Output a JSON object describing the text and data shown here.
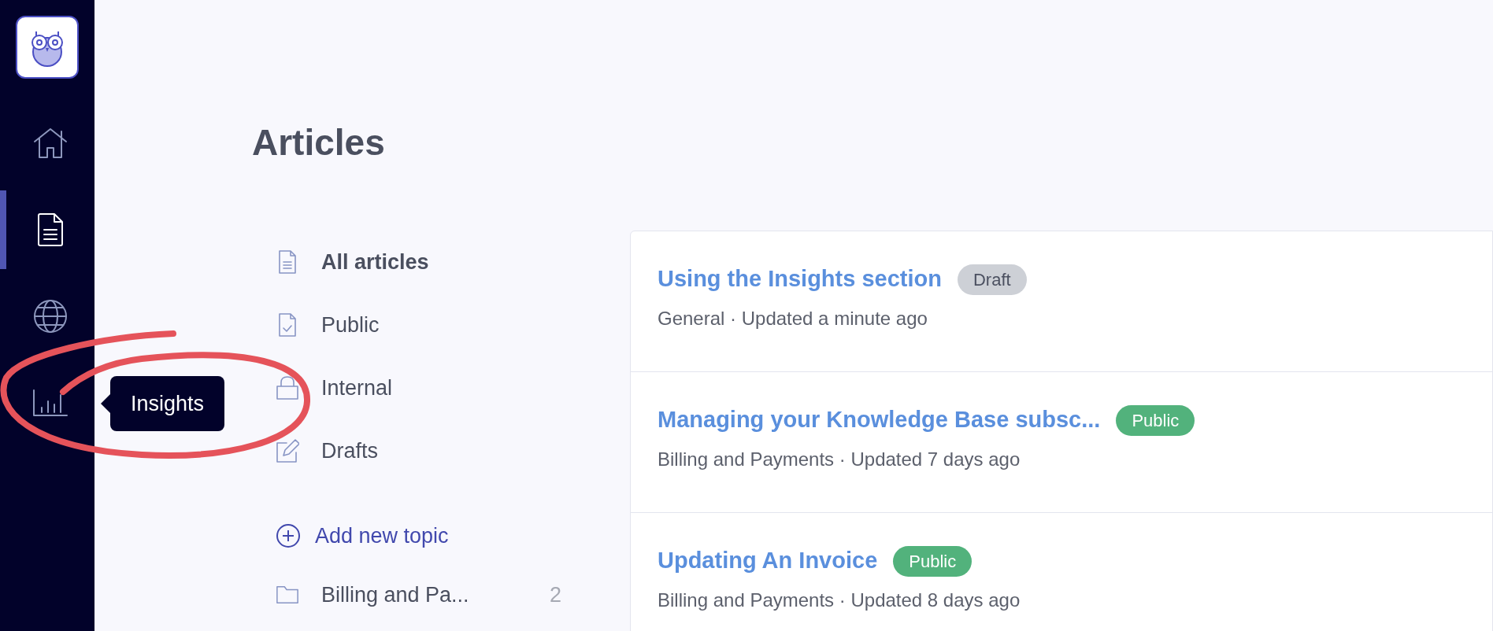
{
  "sidebar": {
    "items": [
      {
        "kind": "home",
        "selected": false
      },
      {
        "kind": "articles",
        "selected": true
      },
      {
        "kind": "globe",
        "selected": false
      },
      {
        "kind": "insights",
        "selected": false
      }
    ],
    "tooltip": "Insights"
  },
  "page_title": "Articles",
  "filters": [
    {
      "kind": "all",
      "label": "All articles",
      "selected": true
    },
    {
      "kind": "public",
      "label": "Public",
      "selected": false
    },
    {
      "kind": "internal",
      "label": "Internal",
      "selected": false
    },
    {
      "kind": "drafts",
      "label": "Drafts",
      "selected": false
    }
  ],
  "add_topic": "Add new topic",
  "topics": [
    {
      "label": "Billing and Pa...",
      "count": "2"
    }
  ],
  "articles": [
    {
      "title": "Using the Insights section",
      "status": {
        "label": "Draft",
        "kind": "draft"
      },
      "meta": "General · Updated a minute ago"
    },
    {
      "title": "Managing your Knowledge Base subsc...",
      "status": {
        "label": "Public",
        "kind": "public"
      },
      "meta": "Billing and Payments · Updated 7 days ago"
    },
    {
      "title": "Updating An Invoice",
      "status": {
        "label": "Public",
        "kind": "public"
      },
      "meta": "Billing and Payments · Updated 8 days ago"
    }
  ]
}
